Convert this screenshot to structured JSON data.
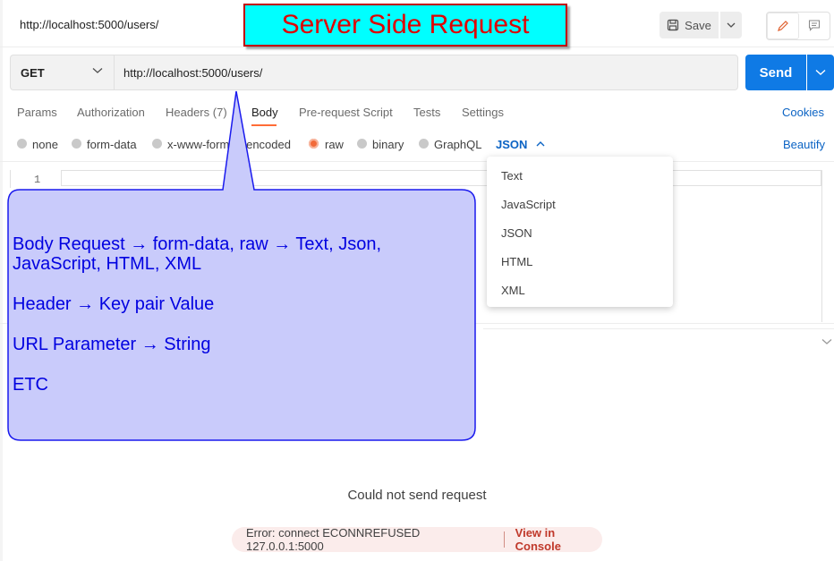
{
  "header": {
    "url": "http://localhost:5000/users/",
    "save_label": "Save"
  },
  "banner": {
    "text": "Server Side Request",
    "bg_color": "#00ffff",
    "text_color": "#e00000"
  },
  "request": {
    "method": "GET",
    "url": "http://localhost:5000/users/",
    "send_label": "Send",
    "accent": "#0f7ae5"
  },
  "tabs": {
    "params": "Params",
    "authorization": "Authorization",
    "headers": "Headers",
    "headers_count": "(7)",
    "body": "Body",
    "prerequest": "Pre-request Script",
    "tests": "Tests",
    "settings": "Settings",
    "cookies": "Cookies"
  },
  "body_types": {
    "none": "none",
    "form_data": "form-data",
    "urlencoded": "x-www-form-urlencoded",
    "raw": "raw",
    "binary": "binary",
    "graphql": "GraphQL",
    "selected_format": "JSON",
    "beautify": "Beautify"
  },
  "editor": {
    "line_number": "1"
  },
  "format_dropdown": {
    "options": [
      "Text",
      "JavaScript",
      "JSON",
      "HTML",
      "XML"
    ]
  },
  "callout": {
    "line1": "Body Request → form-data, raw → Text, Json, JavaScript, HTML, XML",
    "line2": "Header → Key pair Value",
    "line3": "URL Parameter → String",
    "line4": "ETC"
  },
  "response": {
    "message": "Could not send request",
    "error": "Error: connect ECONNREFUSED 127.0.0.1:5000",
    "view_console": "View in Console"
  }
}
